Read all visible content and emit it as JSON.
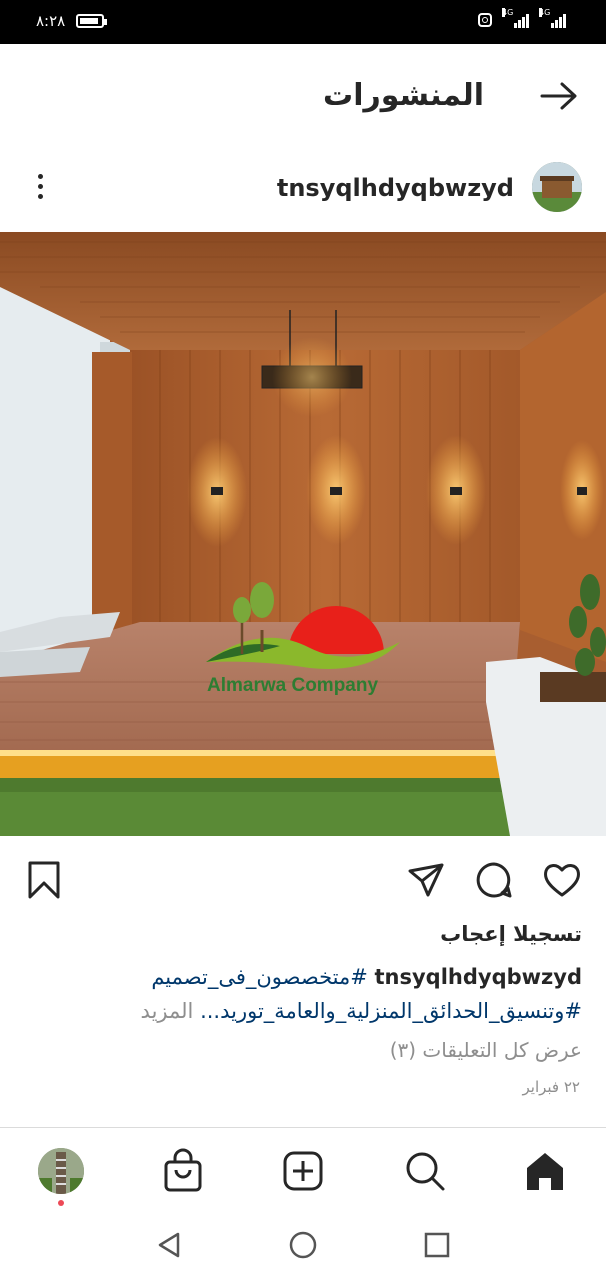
{
  "status_bar": {
    "time": "٨:٢٨",
    "battery_level": 0.9,
    "network_label_1": "4G",
    "network_label_2": "4G"
  },
  "header": {
    "title": "المنشورات"
  },
  "post": {
    "username": "tnsyqlhdyqbwzyd",
    "watermark_text": "Almarwa Company",
    "likes_text": "تسجيلا إعجاب",
    "caption": {
      "username": "tnsyqlhdyqbwzyd",
      "line1_hashtag": "#متخصصون_فى_تصميم",
      "line2_hashtag": "#وتنسيق_الحدائق_المنزلية_والعامة_توريد...",
      "more_label": "المزيد"
    },
    "view_comments": "عرض كل التعليقات (٣)",
    "date": "٢٢ فبراير"
  },
  "colors": {
    "hashtag": "#00376b",
    "muted": "#8e8e8e",
    "text": "#262626",
    "notification_dot": "#ed4956",
    "watermark_green": "#2e7d32",
    "watermark_red": "#e53935"
  },
  "icons": {
    "back": "arrow-right-icon",
    "more": "more-vertical-icon",
    "like": "heart-icon",
    "comment": "comment-icon",
    "share": "send-icon",
    "save": "bookmark-icon",
    "home": "home-icon",
    "search": "search-icon",
    "create": "plus-square-icon",
    "shop": "shopping-bag-icon"
  }
}
